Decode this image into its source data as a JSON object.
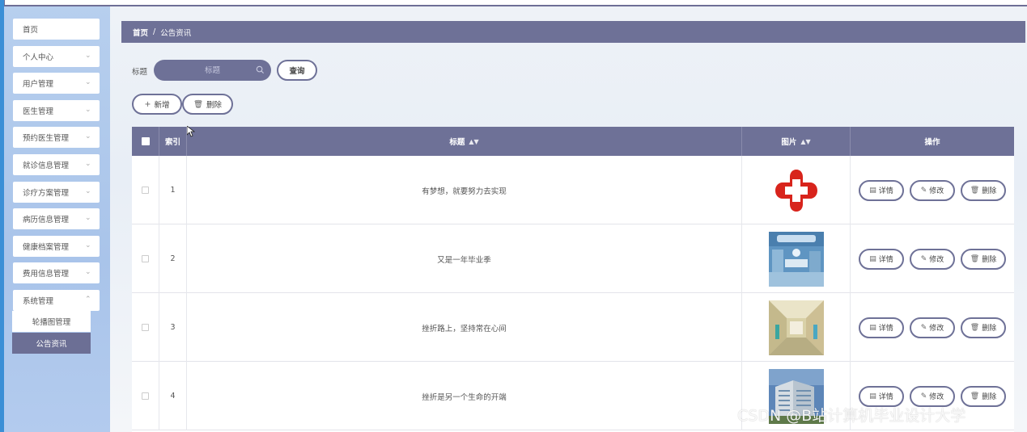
{
  "sidebar": {
    "items": [
      {
        "label": "首页",
        "has_chevron": false
      },
      {
        "label": "个人中心",
        "has_chevron": true
      },
      {
        "label": "用户管理",
        "has_chevron": true
      },
      {
        "label": "医生管理",
        "has_chevron": true
      },
      {
        "label": "预约医生管理",
        "has_chevron": true
      },
      {
        "label": "就诊信息管理",
        "has_chevron": true
      },
      {
        "label": "诊疗方案管理",
        "has_chevron": true
      },
      {
        "label": "病历信息管理",
        "has_chevron": true
      },
      {
        "label": "健康档案管理",
        "has_chevron": true
      },
      {
        "label": "费用信息管理",
        "has_chevron": true
      },
      {
        "label": "系统管理",
        "has_chevron": true
      }
    ],
    "submenu": [
      {
        "label": "轮播图管理",
        "active": false
      },
      {
        "label": "公告资讯",
        "active": true
      }
    ]
  },
  "breadcrumb": {
    "home": "首页",
    "separator": "/",
    "current": "公告资讯"
  },
  "search": {
    "label": "标题",
    "placeholder": "标题",
    "query_button": "查询"
  },
  "actions": {
    "add": "新增",
    "delete": "删除"
  },
  "table": {
    "headers": {
      "index": "索引",
      "title": "标题",
      "image": "图片",
      "operation": "操作"
    },
    "rows": [
      {
        "index": "1",
        "title": "有梦想，就要努力去实现",
        "image": "red-cross-logo"
      },
      {
        "index": "2",
        "title": "又是一年毕业季",
        "image": "operating-room-photo"
      },
      {
        "index": "3",
        "title": "挫折路上，坚持常在心间",
        "image": "hospital-corridor-photo"
      },
      {
        "index": "4",
        "title": "挫折是另一个生命的开端",
        "image": "hospital-building-photo"
      }
    ],
    "row_actions": {
      "detail": "详情",
      "edit": "修改",
      "delete": "删除"
    }
  },
  "watermark": "CSDN @B站计算机毕业设计大学",
  "colors": {
    "primary": "#6e7197",
    "sidebar": "#b3cbee",
    "accent_blue": "#3b8fd6"
  }
}
